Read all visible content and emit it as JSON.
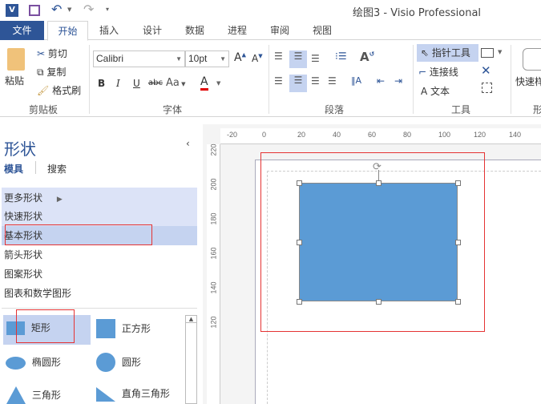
{
  "titlebar": {
    "title": "绘图3 - Visio Professional"
  },
  "tabs": [
    {
      "label": "文件"
    },
    {
      "label": "开始"
    },
    {
      "label": "插入"
    },
    {
      "label": "设计"
    },
    {
      "label": "数据"
    },
    {
      "label": "进程"
    },
    {
      "label": "审阅"
    },
    {
      "label": "视图"
    }
  ],
  "clipboard": {
    "paste": "粘贴",
    "cut": "剪切",
    "copy": "复制",
    "format_painter": "格式刷",
    "label": "剪贴板"
  },
  "font": {
    "family": "Calibri",
    "size": "10pt",
    "bold": "B",
    "italic": "I",
    "underline": "U",
    "strike": "abc",
    "case": "Aa",
    "color_letter": "A",
    "label": "字体",
    "color": "#e00000"
  },
  "paragraph": {
    "label": "段落"
  },
  "tools": {
    "pointer": "指针工具",
    "connector": "连接线",
    "text": "文本",
    "label": "工具"
  },
  "quick_styles": {
    "label": "快速样",
    "group": "形"
  },
  "shapes_panel": {
    "title": "形状",
    "tab_stencils": "模具",
    "tab_search": "搜索",
    "stencils": [
      {
        "label": "更多形状"
      },
      {
        "label": "快速形状"
      },
      {
        "label": "基本形状"
      },
      {
        "label": "箭头形状"
      },
      {
        "label": "图案形状"
      },
      {
        "label": "图表和数学图形"
      }
    ],
    "shapes": [
      {
        "label": "矩形"
      },
      {
        "label": "正方形"
      },
      {
        "label": "椭圆形"
      },
      {
        "label": "圆形"
      },
      {
        "label": "三角形"
      },
      {
        "label": "直角三角形"
      }
    ]
  },
  "ruler": {
    "h": [
      "-20",
      "0",
      "20",
      "40",
      "60",
      "80",
      "100",
      "120",
      "140"
    ],
    "v": [
      "220",
      "200",
      "180",
      "160",
      "140",
      "120"
    ]
  },
  "colors": {
    "accent": "#2e5597",
    "shape_fill": "#5b9bd5",
    "highlight": "#c5d3f0",
    "annotation": "#e53333"
  }
}
